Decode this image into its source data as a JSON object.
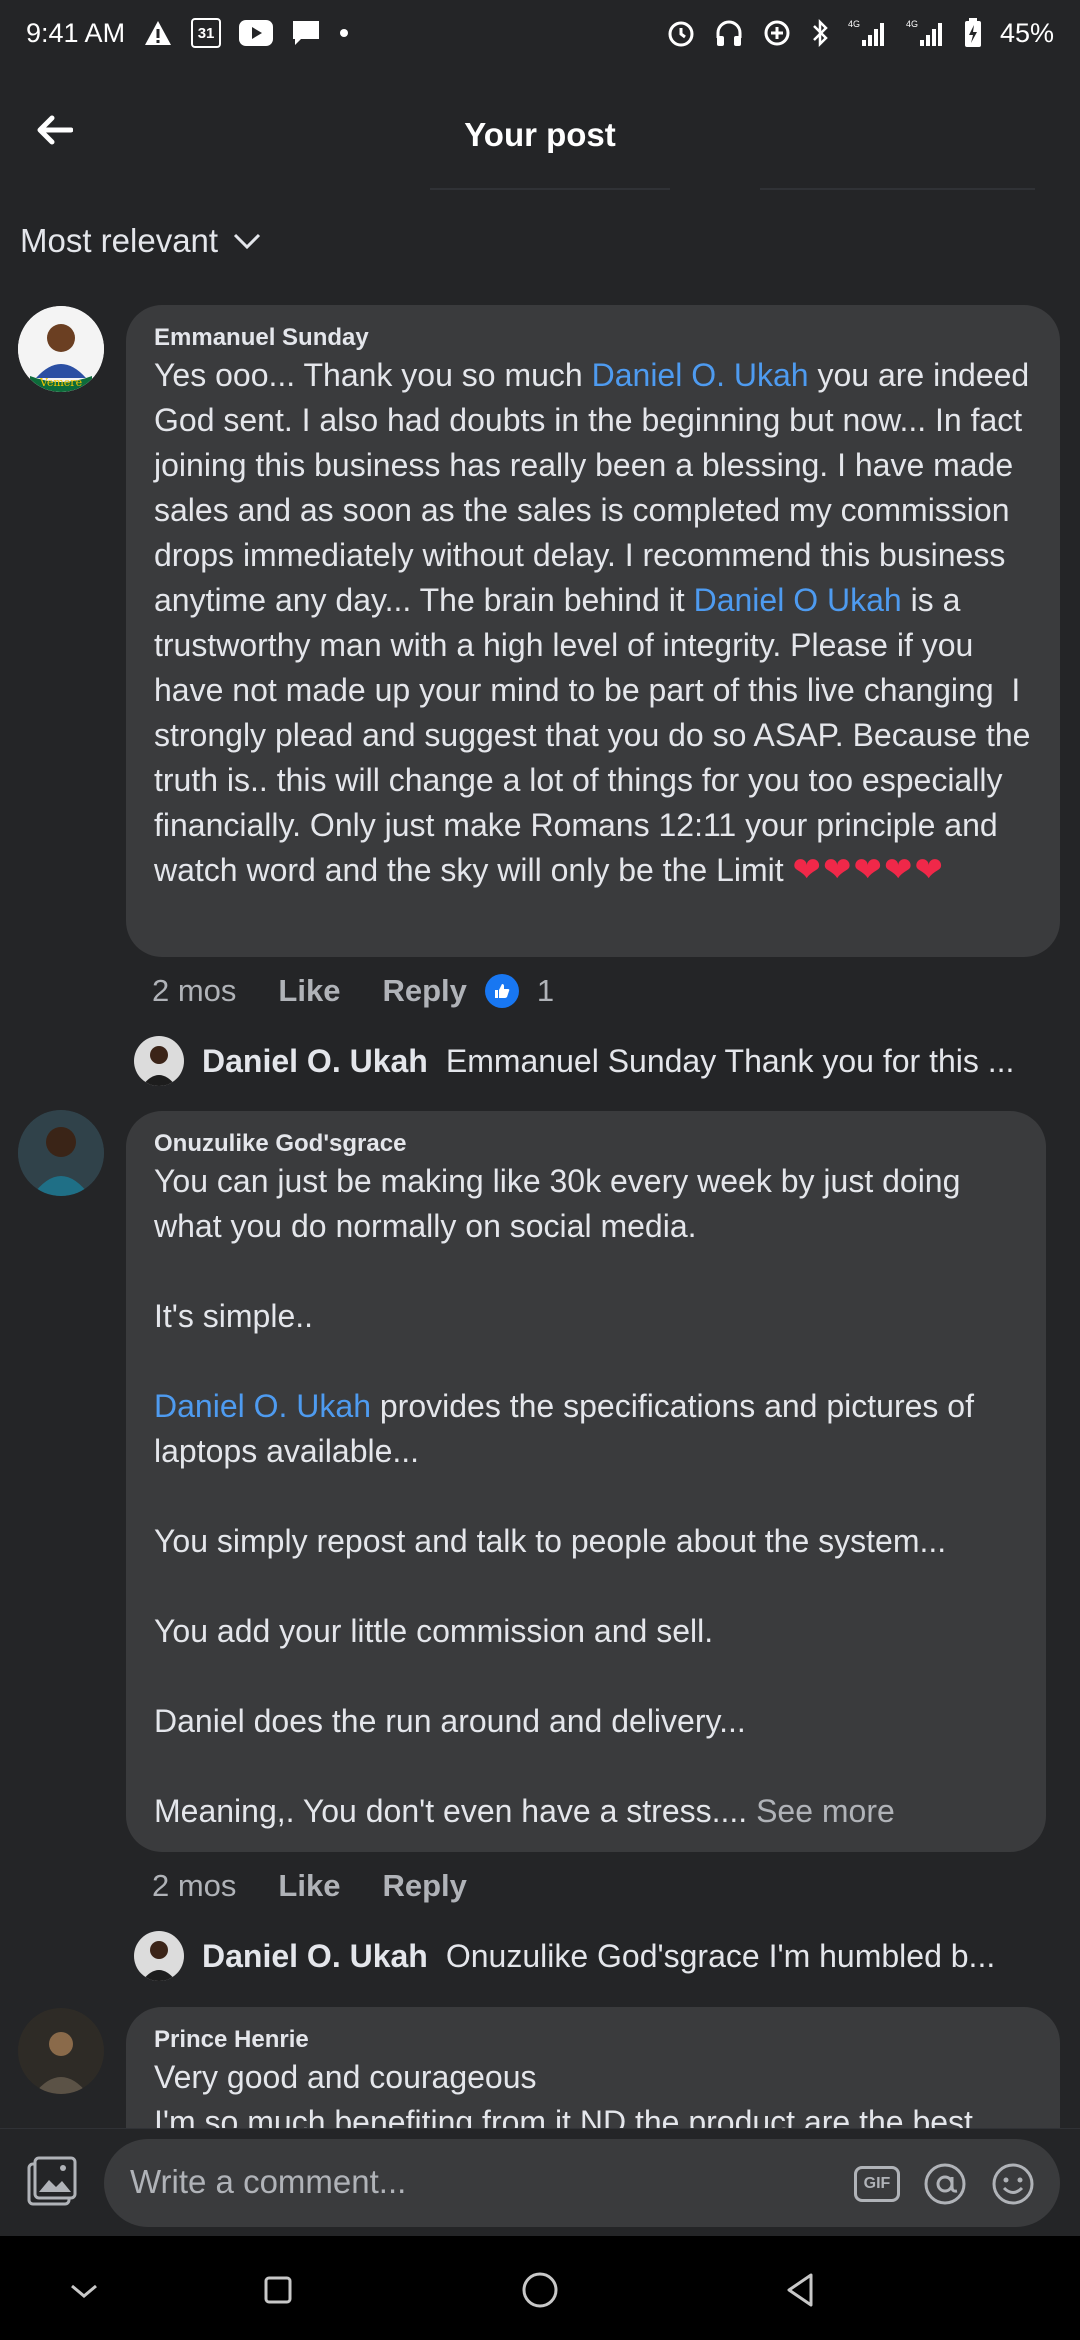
{
  "status_bar": {
    "time": "9:41 AM",
    "calendar_day": "31",
    "battery": "45%",
    "network": "4G"
  },
  "header": {
    "title": "Your post"
  },
  "sort": {
    "label": "Most relevant"
  },
  "comments": [
    {
      "author": "Emmanuel Sunday",
      "segments": [
        {
          "t": "Yes ooo... Thank you so much "
        },
        {
          "t": "Daniel O. Ukah",
          "mention": true
        },
        {
          "t": " you are indeed God sent. I also had doubts in the beginning but now... In fact joining this business has really been a blessing. I have made sales and as soon as the sales is completed my commission drops immediately without delay. I recommend this business anytime any day... The brain behind it "
        },
        {
          "t": "Daniel O Ukah",
          "mention": true
        },
        {
          "t": " is a trustworthy man with a high level of integrity. Please if you have not made up your mind to be part of this live changing  I strongly plead and suggest that you do so ASAP. Because the truth is.. this will change a lot of things for you too especially financially. Only just make Romans 12:11 your principle and watch word and the sky will only be the Limit "
        },
        {
          "t": "❤❤❤❤❤",
          "hearts": true
        }
      ],
      "time": "2 mos",
      "like": "Like",
      "reply": "Reply",
      "reaction_count": "1",
      "reply_preview": {
        "name": "Daniel O. Ukah",
        "text": "Emmanuel Sunday Thank you for this ..."
      }
    },
    {
      "author": "Onuzulike God'sgrace",
      "segments": [
        {
          "t": "You can just be making like 30k every week by just doing what you do normally on social media.\n\nIt's simple..\n\n"
        },
        {
          "t": "Daniel O. Ukah",
          "mention": true
        },
        {
          "t": " provides the specifications and pictures of laptops available...\n\nYou simply repost and talk to people about the system...\n\nYou add your little commission and sell.\n\nDaniel does the run around and delivery...\n\nMeaning,. You don't even have a stress.... "
        },
        {
          "t": "See more",
          "seemore": true
        }
      ],
      "time": "2 mos",
      "like": "Like",
      "reply": "Reply",
      "reply_preview": {
        "name": "Daniel O. Ukah",
        "text": "Onuzulike God'sgrace  I'm humbled b..."
      }
    },
    {
      "author": "Prince Henrie",
      "segments": [
        {
          "t": "Very good and courageous\nI'm so much benefiting from it ND the product are the best"
        }
      ]
    }
  ],
  "composer": {
    "placeholder": "Write a comment...",
    "gif_label": "GIF"
  }
}
